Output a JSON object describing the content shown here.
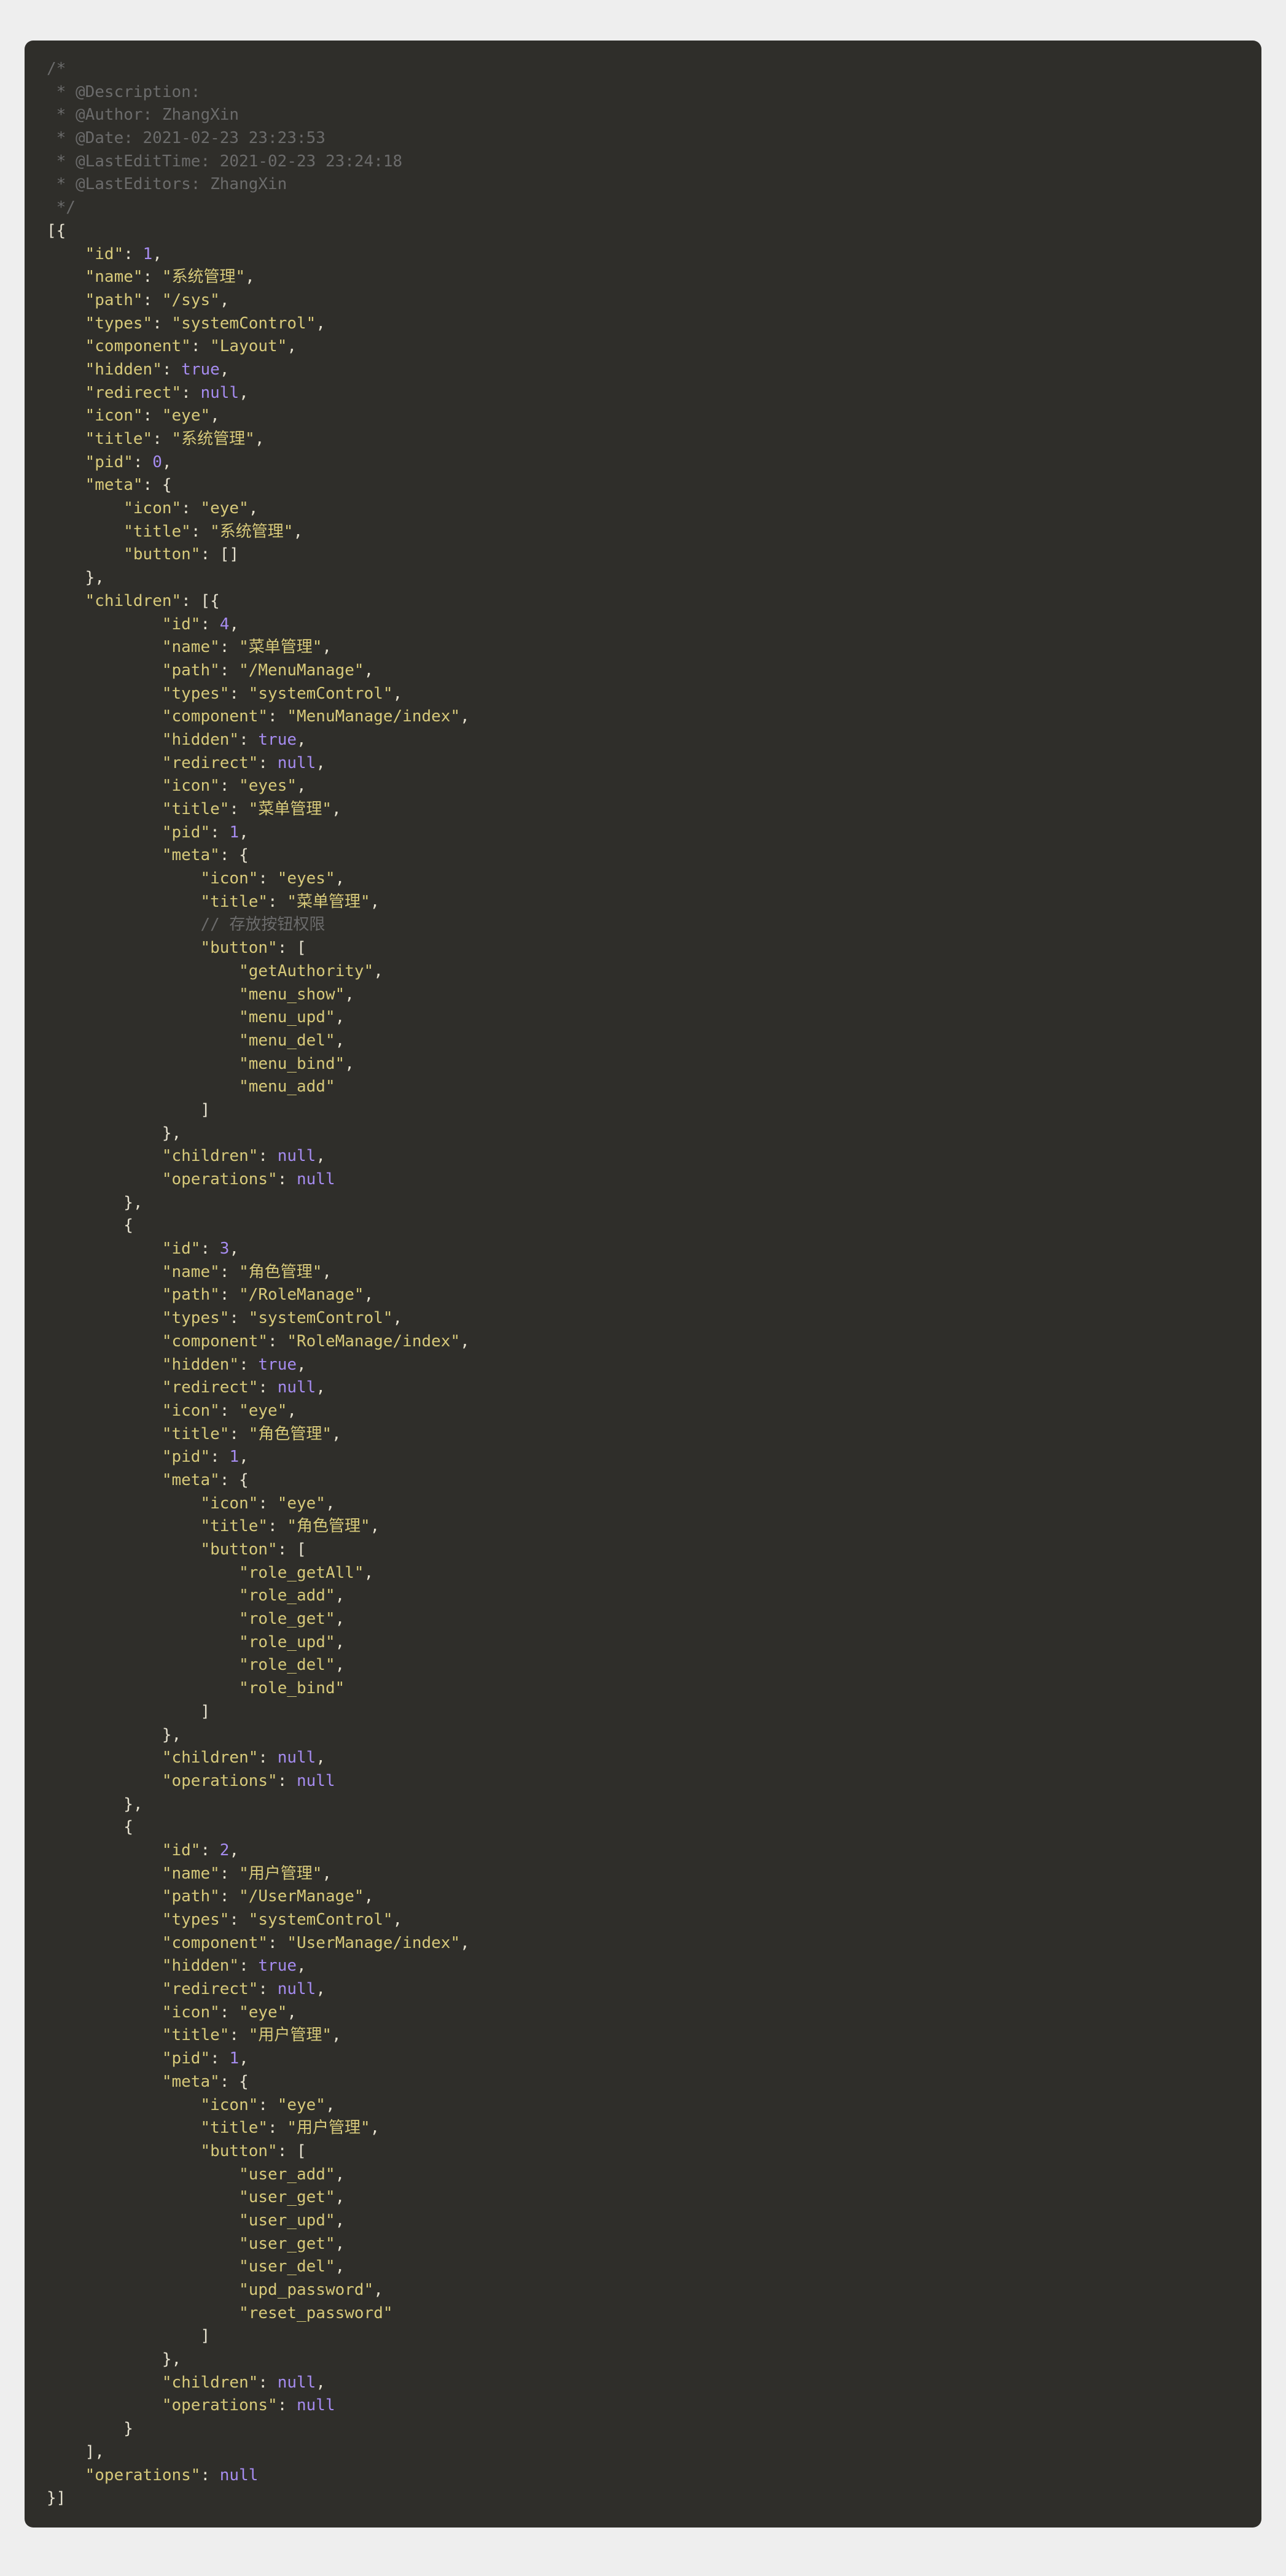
{
  "header_comment": [
    "/*",
    " * @Description:",
    " * @Author: ZhangXin",
    " * @Date: 2021-02-23 23:23:53",
    " * @LastEditTime: 2021-02-23 23:24:18",
    " * @LastEditors: ZhangXin",
    " */"
  ],
  "inline_comment": "// 存放按钮权限",
  "data": [
    {
      "id": 1,
      "name": "系统管理",
      "path": "/sys",
      "types": "systemControl",
      "component": "Layout",
      "hidden": true,
      "redirect": null,
      "icon": "eye",
      "title": "系统管理",
      "pid": 0,
      "meta": {
        "icon": "eye",
        "title": "系统管理",
        "button": []
      },
      "children": [
        {
          "id": 4,
          "name": "菜单管理",
          "path": "/MenuManage",
          "types": "systemControl",
          "component": "MenuManage/index",
          "hidden": true,
          "redirect": null,
          "icon": "eyes",
          "title": "菜单管理",
          "pid": 1,
          "meta": {
            "icon": "eyes",
            "title": "菜单管理",
            "button": [
              "getAuthority",
              "menu_show",
              "menu_upd",
              "menu_del",
              "menu_bind",
              "menu_add"
            ]
          },
          "children": null,
          "operations": null
        },
        {
          "id": 3,
          "name": "角色管理",
          "path": "/RoleManage",
          "types": "systemControl",
          "component": "RoleManage/index",
          "hidden": true,
          "redirect": null,
          "icon": "eye",
          "title": "角色管理",
          "pid": 1,
          "meta": {
            "icon": "eye",
            "title": "角色管理",
            "button": [
              "role_getAll",
              "role_add",
              "role_get",
              "role_upd",
              "role_del",
              "role_bind"
            ]
          },
          "children": null,
          "operations": null
        },
        {
          "id": 2,
          "name": "用户管理",
          "path": "/UserManage",
          "types": "systemControl",
          "component": "UserManage/index",
          "hidden": true,
          "redirect": null,
          "icon": "eye",
          "title": "用户管理",
          "pid": 1,
          "meta": {
            "icon": "eye",
            "title": "用户管理",
            "button": [
              "user_add",
              "user_get",
              "user_upd",
              "user_get",
              "user_del",
              "upd_password",
              "reset_password"
            ]
          },
          "children": null,
          "operations": null
        }
      ],
      "operations": null
    }
  ]
}
